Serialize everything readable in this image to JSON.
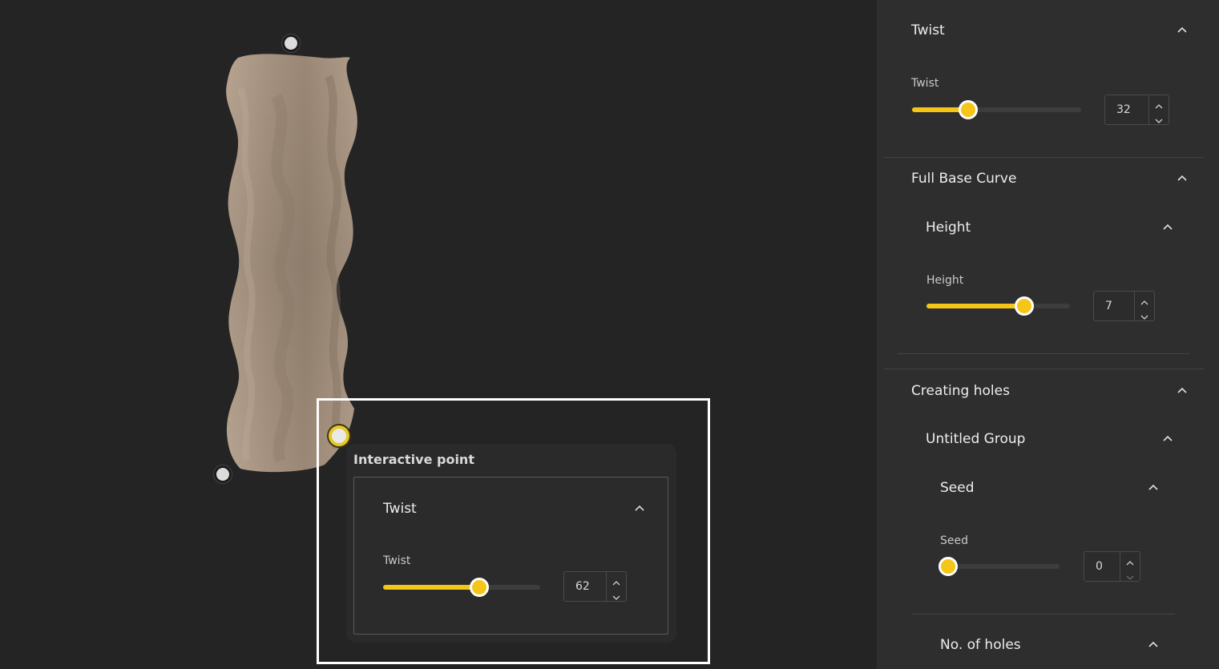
{
  "viewport": {
    "popover": {
      "title": "Interactive point",
      "section_title": "Twist",
      "param_label": "Twist",
      "value": "62",
      "slider_fraction": 0.61
    }
  },
  "sidebar": {
    "twist": {
      "title": "Twist",
      "param_label": "Twist",
      "value": "32",
      "slider_fraction": 0.33
    },
    "full_base_curve": {
      "title": "Full Base Curve",
      "height_group": {
        "title": "Height",
        "param_label": "Height",
        "value": "7",
        "slider_fraction": 0.68
      }
    },
    "creating_holes": {
      "title": "Creating holes",
      "untitled_group": {
        "title": "Untitled Group",
        "seed": {
          "title": "Seed",
          "param_label": "Seed",
          "value": "0",
          "slider_fraction": 0.0
        },
        "no_of_holes": {
          "title": "No. of holes"
        }
      }
    }
  },
  "colors": {
    "accent": "#f5c518",
    "background": "#242424",
    "panel": "#2e2e2e",
    "shape": "#a89482"
  },
  "icons": {
    "collapse": "chevron-up-icon",
    "spin_up": "chevron-up-icon",
    "spin_down": "chevron-down-icon"
  }
}
